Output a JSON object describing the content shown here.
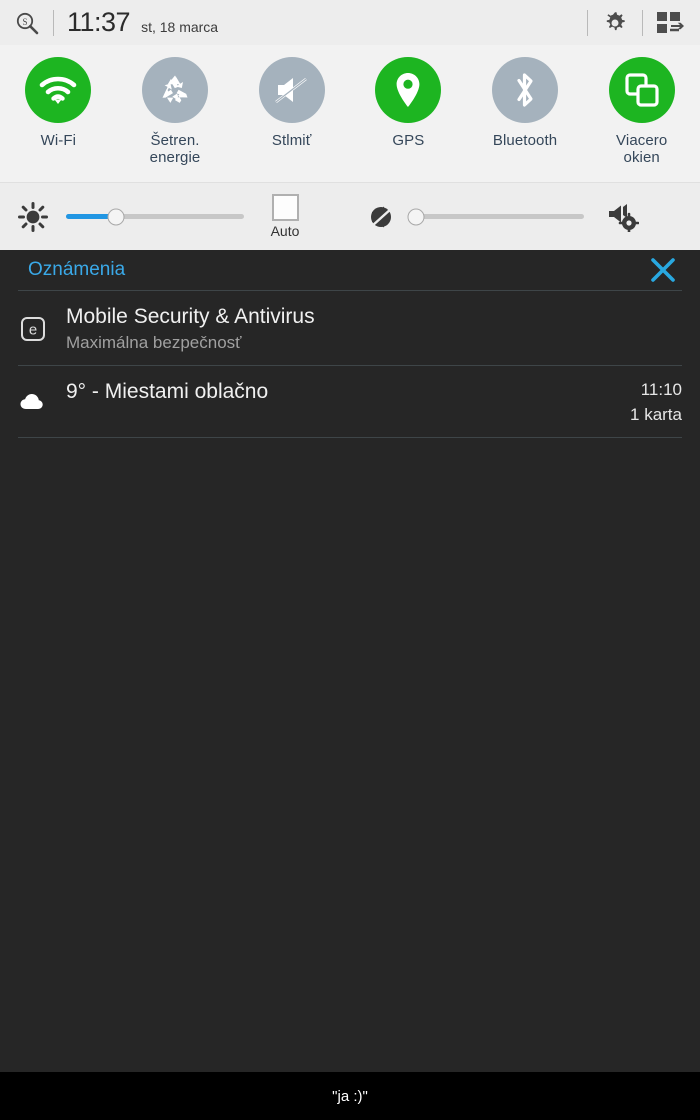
{
  "statusbar": {
    "search_icon": "search-magnifier-icon",
    "time": "11:37",
    "date": "st, 18 marca",
    "settings_icon": "gear-icon",
    "quick_panel_icon": "quick-settings-grid-icon"
  },
  "toggles": [
    {
      "label": "Wi-Fi",
      "icon": "wifi-icon",
      "active": true,
      "color": "#1db521"
    },
    {
      "label": "Šetren.\nenergie",
      "icon": "power-saving-recycle-icon",
      "active": false,
      "color": "#a5b2bd"
    },
    {
      "label": "Stlmiť",
      "icon": "mute-speaker-icon",
      "active": false,
      "color": "#a5b2bd"
    },
    {
      "label": "GPS",
      "icon": "location-pin-icon",
      "active": true,
      "color": "#1db521"
    },
    {
      "label": "Bluetooth",
      "icon": "bluetooth-icon",
      "active": false,
      "color": "#a5b2bd"
    },
    {
      "label": "Viacero\nokien",
      "icon": "multi-window-icon",
      "active": true,
      "color": "#1db521"
    }
  ],
  "brightness": {
    "icon": "brightness-sun-icon",
    "value_percent": 28,
    "fill_color": "#2196e3",
    "auto_label": "Auto",
    "auto_checked": false
  },
  "volume": {
    "icon": "volume-muted-icon",
    "value_percent": 0,
    "settings_icon": "sound-settings-icon"
  },
  "notifications": {
    "header_title": "Oznámenia",
    "close_icon": "close-x-icon",
    "accent_color": "#3aa9e8",
    "items": [
      {
        "icon": "eset-security-icon",
        "title": "Mobile Security & Antivirus",
        "subtitle": "Maximálna bezpečnosť",
        "time": "",
        "meta": ""
      },
      {
        "icon": "cloud-weather-icon",
        "title": "9° - Miestami oblačno",
        "subtitle": "",
        "time": "11:10",
        "meta": "1 karta"
      }
    ]
  },
  "bottombar": {
    "text": "\"ja :)\""
  }
}
